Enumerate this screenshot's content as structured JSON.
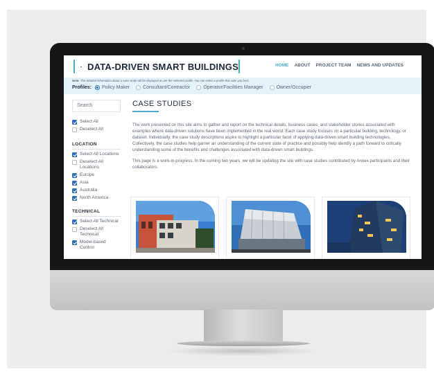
{
  "site": {
    "title": "DATA-DRIVEN SMART BUILDINGS",
    "nav": [
      "HOME",
      "ABOUT",
      "PROJECT TEAM",
      "NEWS AND UPDATES"
    ],
    "active_nav": "HOME"
  },
  "profile_bar": {
    "note_label": "Note:",
    "note": "The detailed information about a case study will be displayed as per the selected profile. You can select a profile that suits you best.",
    "label": "Profiles:",
    "options": [
      "Policy Maker",
      "Consultant/Contractor",
      "Operator/Facilities Manager",
      "Owner/Occupier"
    ],
    "selected": "Policy Maker"
  },
  "sidebar": {
    "search_placeholder": "Search",
    "top_options": [
      {
        "label": "Select All",
        "checked": true
      },
      {
        "label": "Deselect All",
        "checked": false
      }
    ],
    "location": {
      "heading": "LOCATION",
      "options": [
        {
          "label": "Select All Locations",
          "checked": true
        },
        {
          "label": "Deselect All Locations",
          "checked": false
        },
        {
          "label": "Europe",
          "checked": true
        },
        {
          "label": "Asia",
          "checked": true
        },
        {
          "label": "Australia",
          "checked": true
        },
        {
          "label": "North America",
          "checked": true
        }
      ]
    },
    "technical": {
      "heading": "TECHNICAL",
      "options": [
        {
          "label": "Select All Technical",
          "checked": true
        },
        {
          "label": "Deselect All Technical",
          "checked": false
        },
        {
          "label": "Model-based Control",
          "checked": true
        }
      ]
    }
  },
  "main": {
    "title": "CASE STUDIES",
    "paragraph1": "The work presented on this site aims to gather and report on the technical details, business cases, and stakeholder stories associated with examples where data-driven solutions have been implemented in the real world. Each case study focuses on a particular building, technology, or dataset. Individually, the case study descriptions aspire to highlight a particular facet of applying data-driven smart building technologies. Collectively, the case studies help garner an understanding of the current state of practice and possibly help identify a path forward to critically understanding some of the benefits and challenges associated with data-driven smart buildings.",
    "paragraph2": "This page is a work-in-progress. In the coming two years, we will be updating the site with case studies contributed by Annex participants and their collaborators."
  },
  "colors": {
    "accent": "#4aa9cf",
    "checkbox": "#2f6fb5",
    "profile_band": "#e4f2f9",
    "heading_text": "#1f2a36"
  }
}
